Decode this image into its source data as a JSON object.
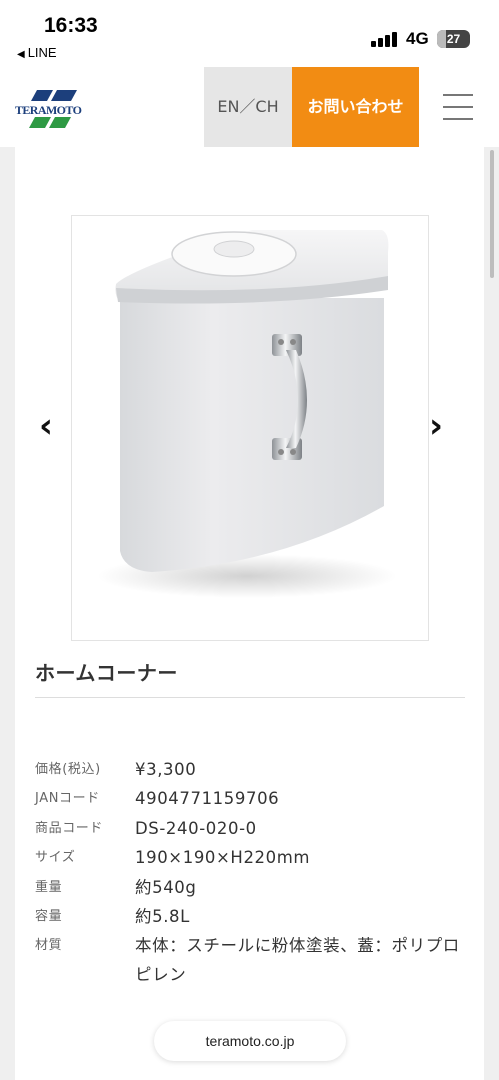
{
  "status_bar": {
    "time": "16:33",
    "back_app": "LINE",
    "network": "4G",
    "battery": "27",
    "battery_level": 0.27
  },
  "header": {
    "logo_text": "TERAMOTO",
    "lang_label": "EN／CH",
    "contact_label": "お問い合わせ",
    "accent_color": "#f28c13",
    "logo_colors": [
      "#1c3f7c",
      "#2e9a44"
    ]
  },
  "carousel": {
    "prev_icon": "chevron-left-icon",
    "next_icon": "chevron-right-icon",
    "prev_glyph": "‹",
    "next_glyph": "›"
  },
  "product": {
    "name": "ホームコーナー",
    "specs": [
      {
        "label": "価格(税込)",
        "value": "¥3,300"
      },
      {
        "label": "JANコード",
        "value": "4904771159706"
      },
      {
        "label": "商品コード",
        "value": "DS-240-020-0"
      },
      {
        "label": "サイズ",
        "value": "190×190×H220mm"
      },
      {
        "label": "重量",
        "value": "約540g"
      },
      {
        "label": "容量",
        "value": "約5.8L"
      },
      {
        "label": "材質",
        "value": "本体：スチールに粉体塗装、蓋：ポリプロピレン"
      }
    ]
  },
  "browser": {
    "url": "teramoto.co.jp"
  }
}
